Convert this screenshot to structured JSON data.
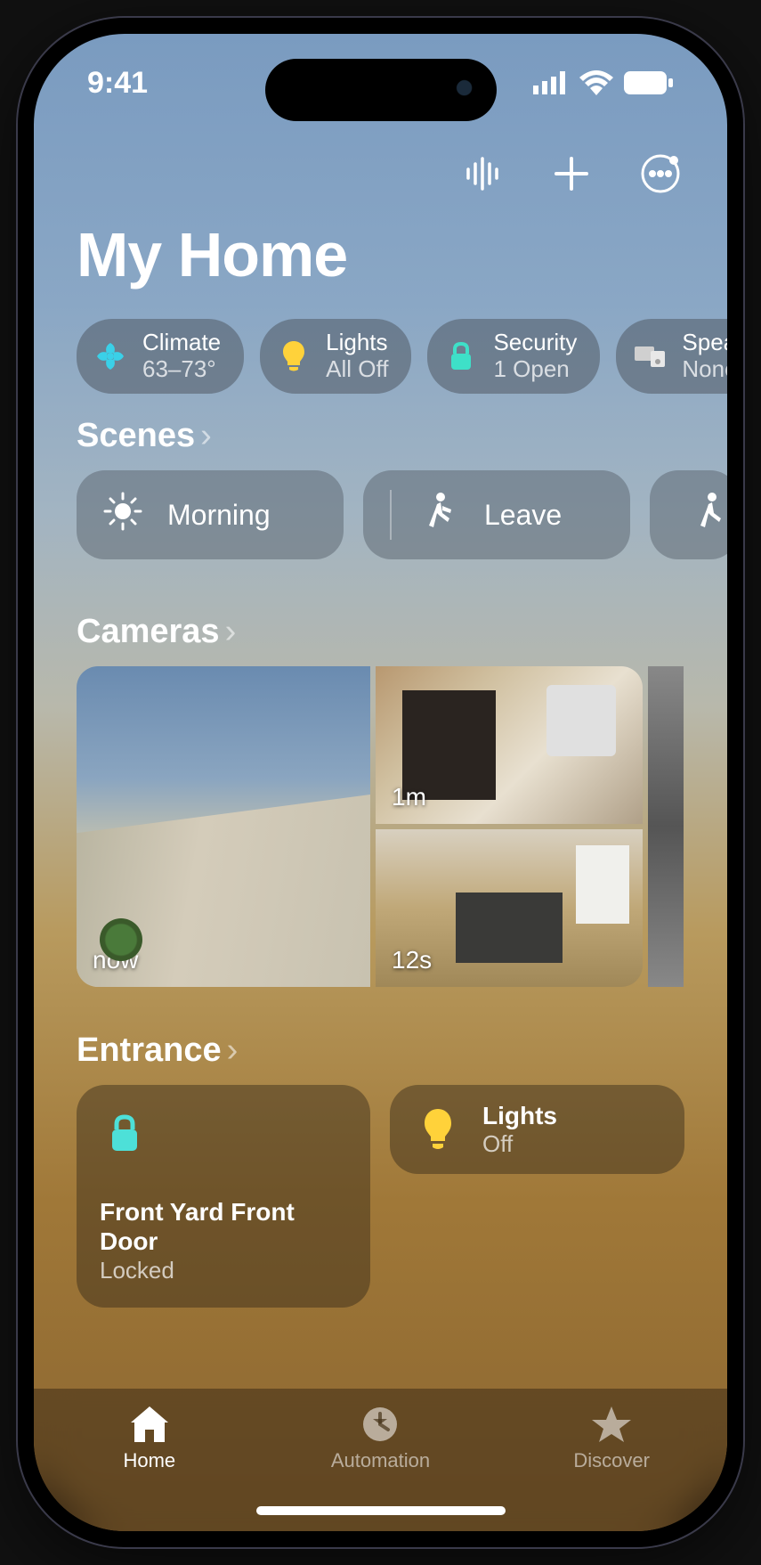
{
  "status": {
    "time": "9:41"
  },
  "header": {
    "title": "My Home"
  },
  "chips": [
    {
      "id": "climate",
      "label": "Climate",
      "sub": "63–73°",
      "iconColor": "#3ad0e8"
    },
    {
      "id": "lights",
      "label": "Lights",
      "sub": "All Off",
      "iconColor": "#ffd23a"
    },
    {
      "id": "security",
      "label": "Security",
      "sub": "1 Open",
      "iconColor": "#3ee0c8"
    },
    {
      "id": "speakers",
      "label": "Spea",
      "sub": "None",
      "iconColor": "#d0d0d0"
    }
  ],
  "sections": {
    "scenes": {
      "title": "Scenes"
    },
    "cameras": {
      "title": "Cameras"
    },
    "entrance": {
      "title": "Entrance"
    }
  },
  "scenes": [
    {
      "id": "morning",
      "label": "Morning"
    },
    {
      "id": "leave",
      "label": "Leave"
    },
    {
      "id": "arrive",
      "label": ""
    }
  ],
  "cameras": [
    {
      "id": "front-yard",
      "timestamp": "now"
    },
    {
      "id": "gym",
      "timestamp": "1m"
    },
    {
      "id": "kitchen",
      "timestamp": "12s"
    }
  ],
  "entrance": {
    "lock": {
      "label": "Front Yard Front Door",
      "sub": "Locked"
    },
    "lights": {
      "label": "Lights",
      "sub": "Off"
    }
  },
  "tabs": [
    {
      "id": "home",
      "label": "Home",
      "active": true
    },
    {
      "id": "automation",
      "label": "Automation",
      "active": false
    },
    {
      "id": "discover",
      "label": "Discover",
      "active": false
    }
  ]
}
